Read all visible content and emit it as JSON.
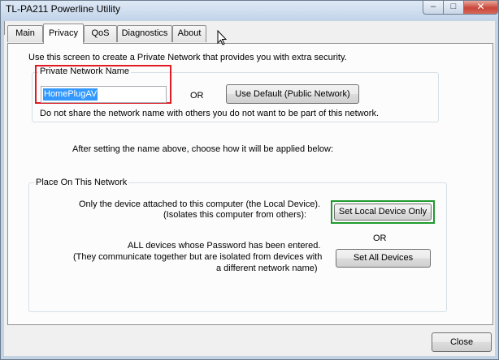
{
  "window": {
    "title": "TL-PA211 Powerline Utility",
    "minimize_glyph": "–",
    "maximize_glyph": "□",
    "close_glyph": "✕"
  },
  "tabs": [
    {
      "label": "Main",
      "active": false
    },
    {
      "label": "Privacy",
      "active": true
    },
    {
      "label": "QoS",
      "active": false
    },
    {
      "label": "Diagnostics",
      "active": false
    },
    {
      "label": "About",
      "active": false
    }
  ],
  "privacy": {
    "intro": "Use this screen to create a Private Network that provides you with extra security.",
    "network_group_label": "Private Network Name",
    "network_name_value": "HomePlugAV",
    "or_label": "OR",
    "use_default_button": "Use Default (Public Network)",
    "warning": "Do not share the network name with others you do not want to be part of this network.",
    "after_setting": "After setting the name above, choose how it will be applied below:",
    "place_group_label": "Place On This Network",
    "local_line1": "Only the device attached to this computer (the Local Device).",
    "local_line2": "(Isolates this computer from others):",
    "set_local_button": "Set Local Device Only",
    "or_label2": "OR",
    "all_line1": "ALL devices whose Password has been entered.",
    "all_line2": "(They communicate together but are isolated from devices with",
    "all_line3": "a different network name)",
    "set_all_button": "Set All Devices"
  },
  "footer": {
    "close_button": "Close"
  },
  "colors": {
    "selection": "#3399ff",
    "highlight_red": "#e01b24",
    "highlight_green": "#1e9b2e"
  },
  "icons": {
    "cursor": "mouse-pointer-icon"
  }
}
